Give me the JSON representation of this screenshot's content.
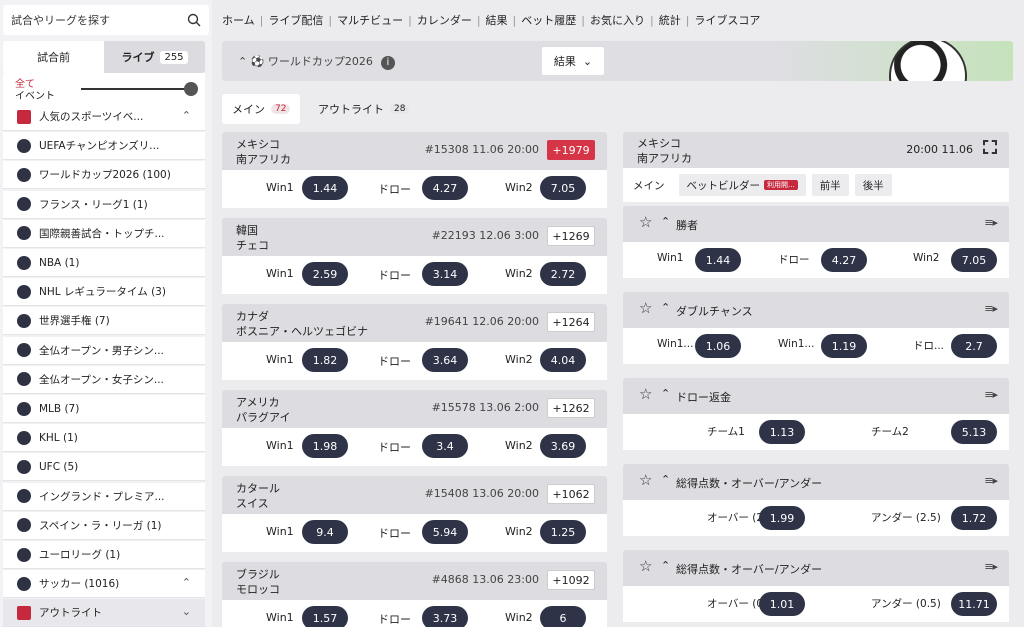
{
  "search": {
    "placeholder": "試合やリーグを探す"
  },
  "tabs": {
    "prematch": "試合前",
    "live": "ライブ",
    "live_count": "255"
  },
  "filter": {
    "all": "全て",
    "event": "イベント"
  },
  "sidebar": [
    {
      "label": "人気のスポーツイベ...",
      "chev": "⌃",
      "icon": "trophy-icon"
    },
    {
      "label": "UEFAチャンピオンズリ...",
      "icon": "soccer-ball-icon"
    },
    {
      "label": "ワールドカップ2026 (100)",
      "icon": "soccer-ball-icon"
    },
    {
      "label": "フランス・リーグ1 (1)",
      "icon": "soccer-ball-icon"
    },
    {
      "label": "国際親善試合・トップチ...",
      "icon": "soccer-ball-icon"
    },
    {
      "label": "NBA (1)",
      "icon": "basketball-icon"
    },
    {
      "label": "NHL レギュラータイム (3)",
      "icon": "hockey-puck-icon"
    },
    {
      "label": "世界選手権 (7)",
      "icon": "hockey-puck-icon"
    },
    {
      "label": "全仏オープン・男子シン...",
      "icon": "tennis-ball-icon"
    },
    {
      "label": "全仏オープン・女子シン...",
      "icon": "tennis-ball-icon"
    },
    {
      "label": "MLB (7)",
      "icon": "baseball-icon"
    },
    {
      "label": "KHL (1)",
      "icon": "hockey-puck-icon"
    },
    {
      "label": "UFC (5)",
      "icon": "mma-glove-icon"
    },
    {
      "label": "イングランド・プレミア...",
      "icon": "soccer-ball-icon"
    },
    {
      "label": "スペイン・ラ・リーガ (1)",
      "icon": "soccer-ball-icon"
    },
    {
      "label": "ユーロリーグ (1)",
      "icon": "basketball-icon"
    },
    {
      "label": "サッカー (1016)",
      "chev": "⌃",
      "icon": "soccer-ball-icon"
    },
    {
      "label": "アウトライト",
      "chev": "⌄",
      "icon": "trophy-icon"
    }
  ],
  "nav": [
    "ホーム",
    "ライブ配信",
    "マルチビュー",
    "カレンダー",
    "結果",
    "ベット履歴",
    "お気に入り",
    "統計",
    "ライブスコア"
  ],
  "banner": {
    "title": "ワールドカップ2026",
    "info": "i",
    "select": "結果"
  },
  "subtabs": {
    "main": "メイン",
    "main_count": "72",
    "outright": "アウトライト",
    "outright_count": "28"
  },
  "labels": {
    "win1": "Win1",
    "draw": "ドロー",
    "win2": "Win2"
  },
  "matches": [
    {
      "team1": "メキシコ",
      "team2": "南アフリカ",
      "id": "#15308",
      "date": "11.06",
      "time": "20:00",
      "plus": "+1979",
      "o1": "1.44",
      "ox": "4.27",
      "o2": "7.05"
    },
    {
      "team1": "韓国",
      "team2": "チェコ",
      "id": "#22193",
      "date": "12.06",
      "time": "3:00",
      "plus": "+1269",
      "o1": "2.59",
      "ox": "3.14",
      "o2": "2.72"
    },
    {
      "team1": "カナダ",
      "team2": "ボスニア・ヘルツェゴビナ",
      "id": "#19641",
      "date": "12.06",
      "time": "20:00",
      "plus": "+1264",
      "o1": "1.82",
      "ox": "3.64",
      "o2": "4.04"
    },
    {
      "team1": "アメリカ",
      "team2": "パラグアイ",
      "id": "#15578",
      "date": "13.06",
      "time": "2:00",
      "plus": "+1262",
      "o1": "1.98",
      "ox": "3.4",
      "o2": "3.69"
    },
    {
      "team1": "カタール",
      "team2": "スイス",
      "id": "#15408",
      "date": "13.06",
      "time": "20:00",
      "plus": "+1062",
      "o1": "9.4",
      "ox": "5.94",
      "o2": "1.25"
    },
    {
      "team1": "ブラジル",
      "team2": "モロッコ",
      "id": "#4868",
      "date": "13.06",
      "time": "23:00",
      "plus": "+1092",
      "o1": "1.57",
      "ox": "3.73",
      "o2": "6"
    }
  ],
  "detail": {
    "team1": "メキシコ",
    "team2": "南アフリカ",
    "time": "20:00",
    "date": "11.06",
    "tabs": [
      "メイン",
      "ベットビルダー",
      "前半",
      "後半"
    ],
    "new_badge": "利用開...",
    "markets": [
      {
        "name": "勝者",
        "outcomes": [
          {
            "label": "Win1",
            "odd": "1.44"
          },
          {
            "label": "ドロー",
            "odd": "4.27"
          },
          {
            "label": "Win2",
            "odd": "7.05"
          }
        ]
      },
      {
        "name": "ダブルチャンス",
        "outcomes": [
          {
            "label": "Win1...",
            "odd": "1.06"
          },
          {
            "label": "Win1...",
            "odd": "1.19"
          },
          {
            "label": "ドロ...",
            "odd": "2.7"
          }
        ]
      },
      {
        "name": "ドロー返金",
        "outcomes": [
          {
            "label": "チーム1",
            "odd": "1.13"
          },
          {
            "label": "チーム2",
            "odd": "5.13"
          }
        ]
      },
      {
        "name": "総得点数・オーバー/アンダー",
        "outcomes": [
          {
            "label": "オーバー (2.5)",
            "odd": "1.99"
          },
          {
            "label": "アンダー (2.5)",
            "odd": "1.72"
          }
        ]
      },
      {
        "name": "総得点数・オーバー/アンダー",
        "outcomes": [
          {
            "label": "オーバー (0.5)",
            "odd": "1.01"
          },
          {
            "label": "アンダー (0.5)",
            "odd": "11.71"
          }
        ]
      }
    ]
  }
}
